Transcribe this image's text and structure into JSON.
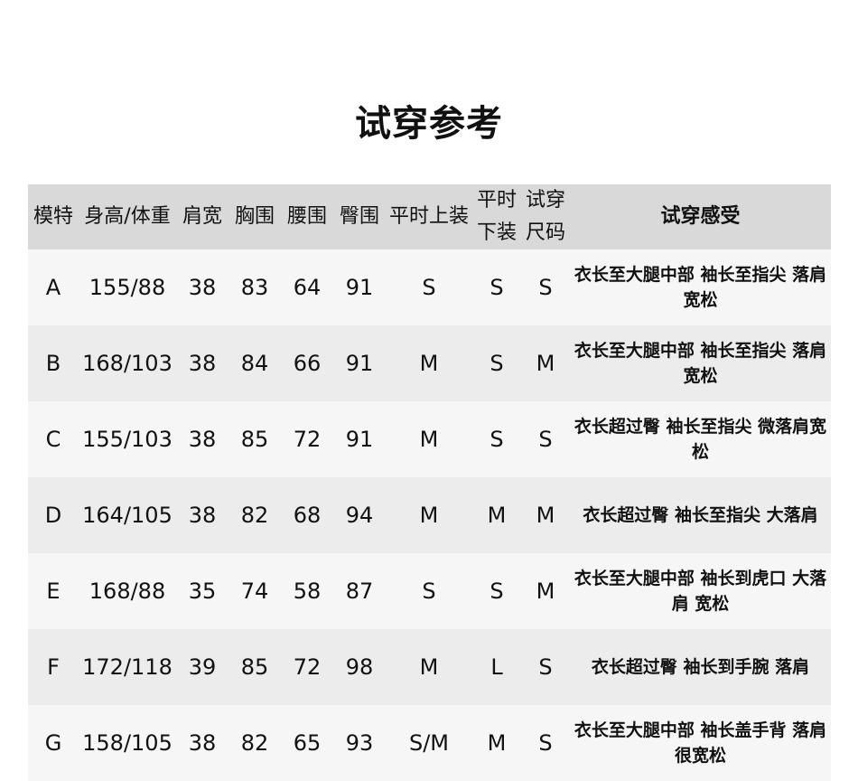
{
  "title": "试穿参考",
  "table": {
    "headers": [
      "模特",
      "身高/体重",
      "肩宽",
      "胸围",
      "腰围",
      "臀围",
      "平时上装",
      [
        "平时",
        "下装"
      ],
      [
        "试穿",
        "尺码"
      ],
      "试穿感受"
    ],
    "rows": [
      [
        "A",
        "155/88",
        "38",
        "83",
        "64",
        "91",
        "S",
        "S",
        "S",
        "衣长至大腿中部 袖长至指尖 落肩宽松"
      ],
      [
        "B",
        "168/103",
        "38",
        "84",
        "66",
        "91",
        "M",
        "S",
        "M",
        "衣长至大腿中部 袖长至指尖 落肩宽松"
      ],
      [
        "C",
        "155/103",
        "38",
        "85",
        "72",
        "91",
        "M",
        "S",
        "S",
        "衣长超过臀 袖长至指尖 微落肩宽松"
      ],
      [
        "D",
        "164/105",
        "38",
        "82",
        "68",
        "94",
        "M",
        "M",
        "M",
        "衣长超过臀 袖长至指尖 大落肩"
      ],
      [
        "E",
        "168/88",
        "35",
        "74",
        "58",
        "87",
        "S",
        "S",
        "M",
        "衣长至大腿中部 袖长到虎口 大落肩 宽松"
      ],
      [
        "F",
        "172/118",
        "39",
        "85",
        "72",
        "98",
        "M",
        "L",
        "S",
        "衣长超过臀 袖长到手腕 落肩"
      ],
      [
        "G",
        "158/105",
        "38",
        "82",
        "65",
        "93",
        "S/M",
        "M",
        "S",
        "衣长至大腿中部 袖长盖手背 落肩很宽松"
      ]
    ]
  }
}
